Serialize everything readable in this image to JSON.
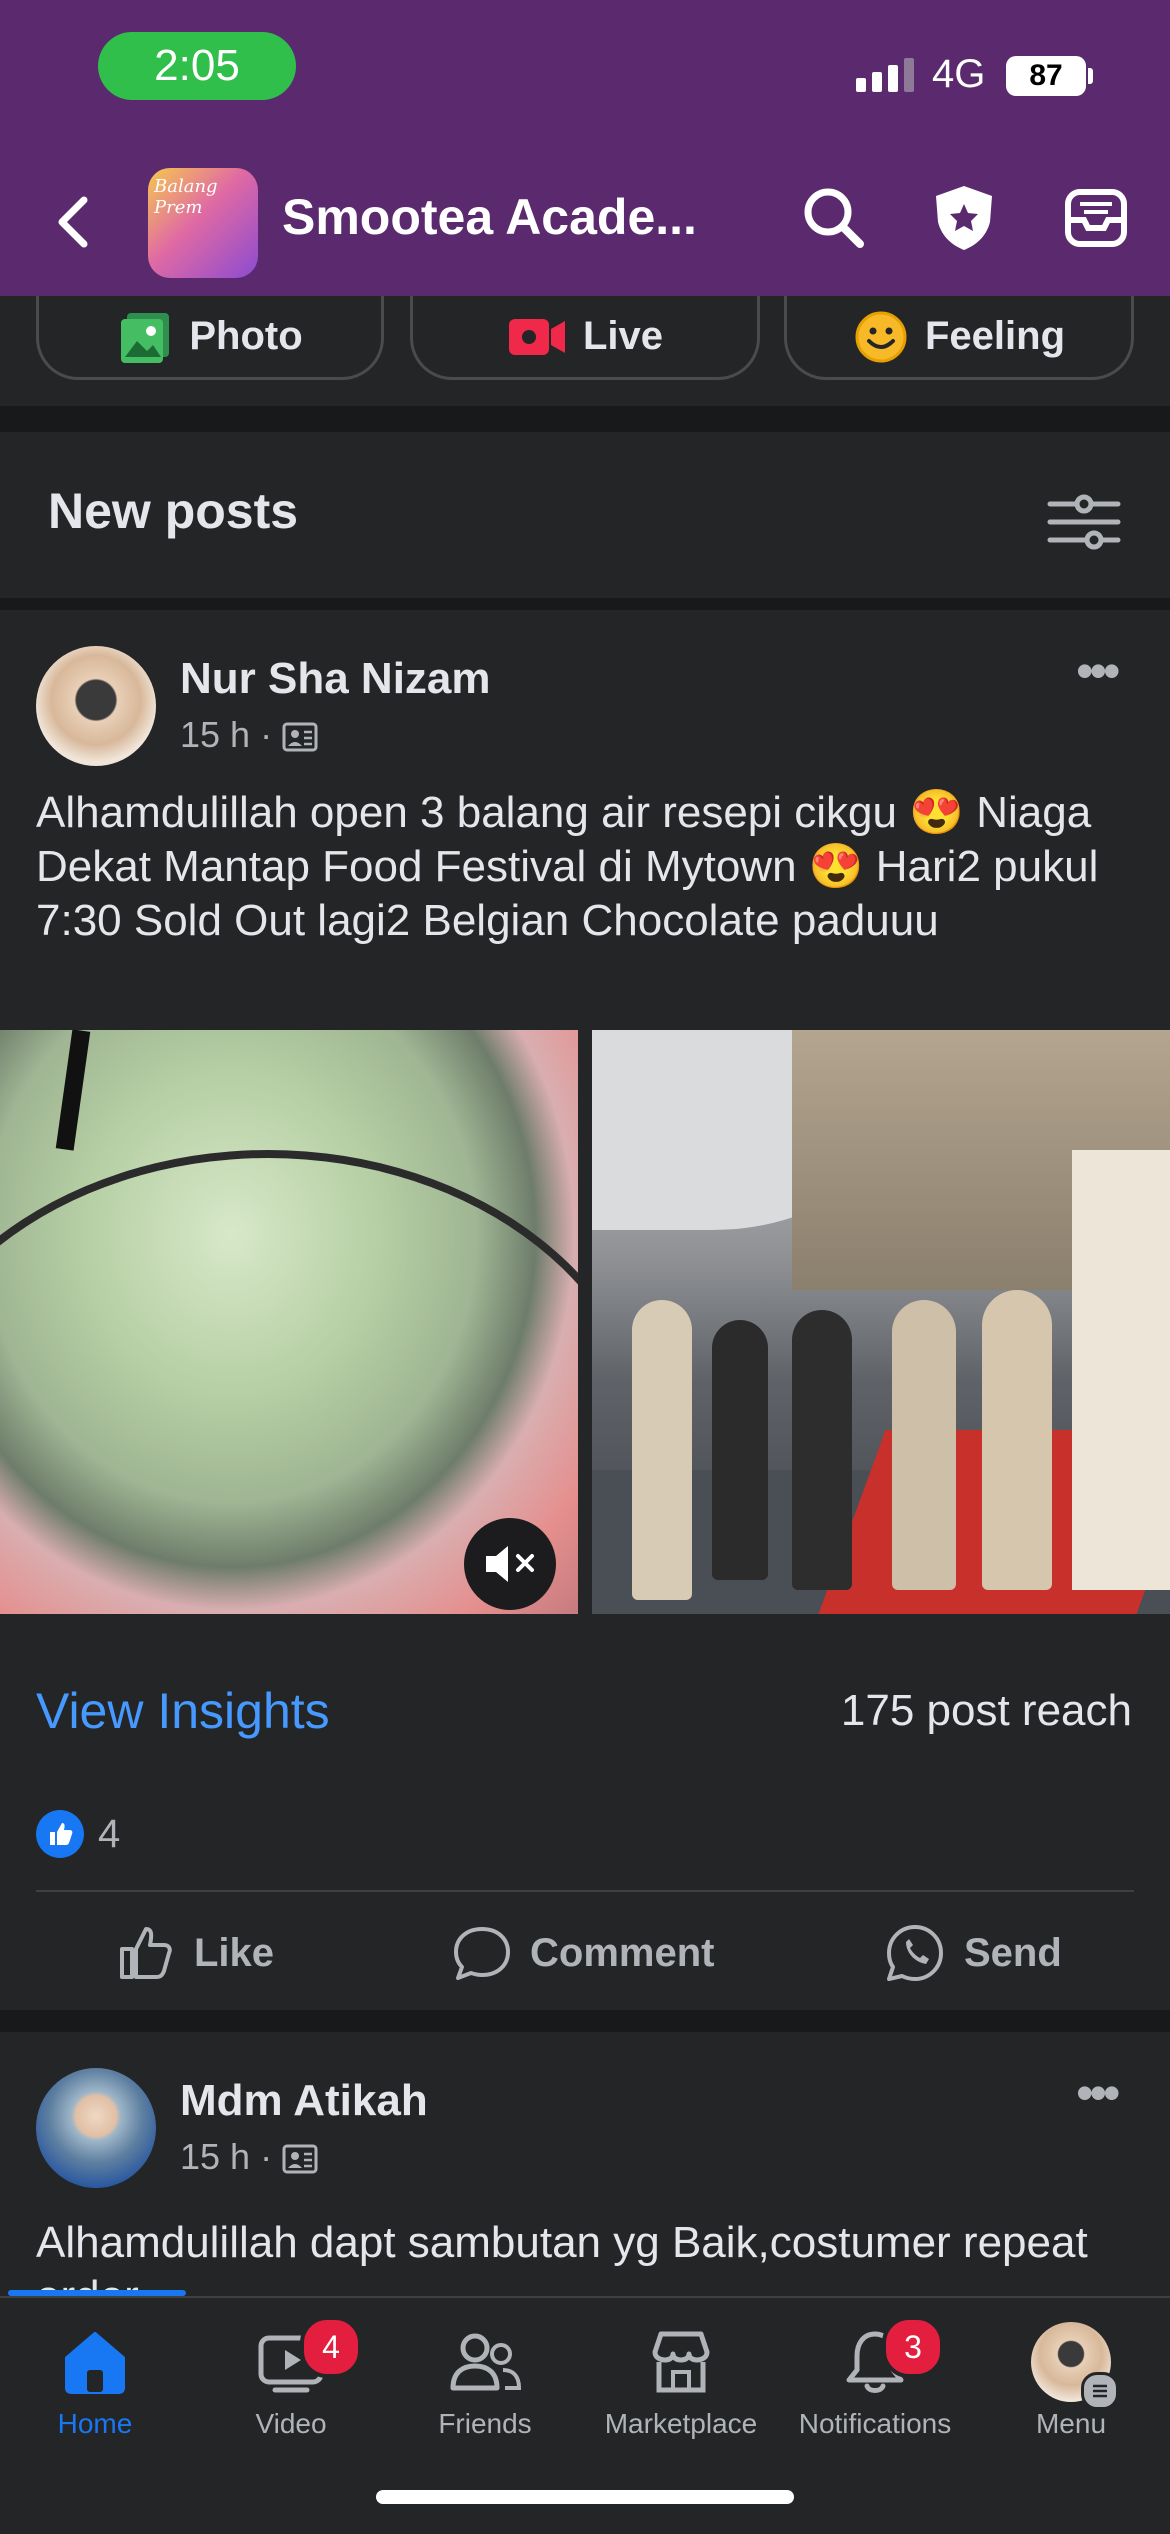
{
  "status_bar": {
    "time": "2:05",
    "network": "4G",
    "battery": "87"
  },
  "nav": {
    "page_title": "Smootea Acade...",
    "thumbnail_text": "Balang Prem"
  },
  "composer": {
    "photo": "Photo",
    "live": "Live",
    "feeling": "Feeling"
  },
  "section": {
    "title": "New posts"
  },
  "post1": {
    "author": "Nur Sha Nizam",
    "time": "15 h",
    "dot": "·",
    "text": "Alhamdulillah open 3 balang air resepi cikgu 😍 Niaga Dekat Mantap Food Festival di Mytown 😍 Hari2 pukul 7:30 Sold Out lagi2 Belgian Chocolate paduuu",
    "insights_label": "View Insights",
    "reach": "175 post reach",
    "like_count": "4",
    "actions": {
      "like": "Like",
      "comment": "Comment",
      "send": "Send"
    }
  },
  "post2": {
    "author": "Mdm Atikah",
    "time": "15 h",
    "dot": "·",
    "text": "Alhamdulillah dapt sambutan yg Baik,costumer repeat order"
  },
  "tabs": {
    "home": "Home",
    "video": "Video",
    "video_badge": "4",
    "friends": "Friends",
    "marketplace": "Marketplace",
    "notifications": "Notifications",
    "notifications_badge": "3",
    "menu": "Menu"
  },
  "colors": {
    "header": "#5b2a6e",
    "accent": "#1877f2",
    "link": "#4599ff",
    "badge": "#e41e3f"
  }
}
